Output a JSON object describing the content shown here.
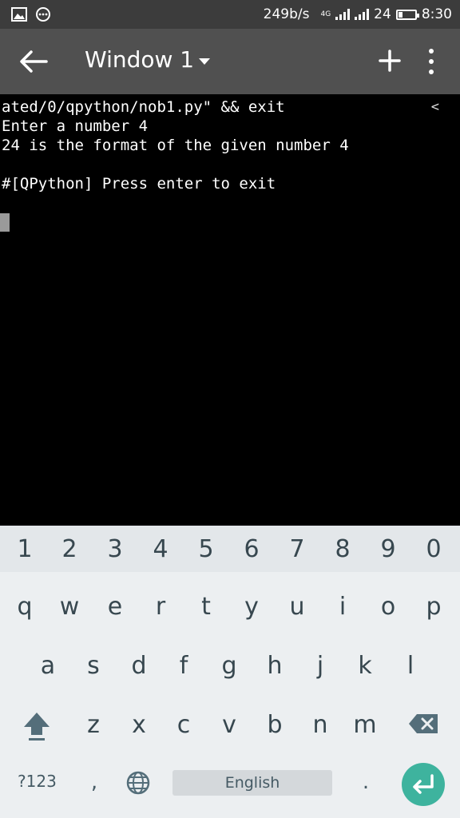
{
  "status_bar": {
    "network_speed": "249b/s",
    "network_type": "4G",
    "battery_level": "24",
    "battery_fraction": 0.24,
    "time": "8:30",
    "icons": [
      "image-icon",
      "chat-icon",
      "signal-icon",
      "battery-icon"
    ]
  },
  "app_bar": {
    "title": "Window 1",
    "icons": [
      "back-arrow-icon",
      "dropdown-caret-icon",
      "plus-icon",
      "more-vert-icon"
    ]
  },
  "terminal": {
    "lines": [
      "ated/0/qpython/nob1.py\" && exit",
      "Enter a number 4",
      "24 is the format of the given number 4",
      "",
      "#[QPython] Press enter to exit"
    ],
    "scroll_indicator": "<"
  },
  "keyboard": {
    "number_row": [
      "1",
      "2",
      "3",
      "4",
      "5",
      "6",
      "7",
      "8",
      "9",
      "0"
    ],
    "row1": [
      "q",
      "w",
      "e",
      "r",
      "t",
      "y",
      "u",
      "i",
      "o",
      "p"
    ],
    "row2": [
      "a",
      "s",
      "d",
      "f",
      "g",
      "h",
      "j",
      "k",
      "l"
    ],
    "row3": [
      "z",
      "x",
      "c",
      "v",
      "b",
      "n",
      "m"
    ],
    "mode_label": "?123",
    "comma_label": ",",
    "space_label": "English",
    "period_label": ".",
    "icons": [
      "shift-icon",
      "backspace-icon",
      "globe-icon",
      "enter-icon"
    ],
    "accent_color": "#3eb39e"
  }
}
